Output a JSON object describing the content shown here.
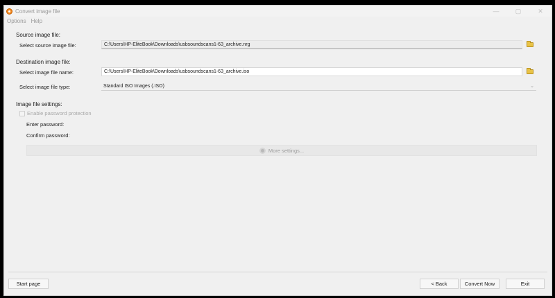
{
  "window": {
    "title": "Convert image file",
    "controls": {
      "minimize": "—",
      "maximize": "▢",
      "close": "✕"
    }
  },
  "menu": [
    "Options",
    "Help"
  ],
  "source": {
    "section_label": "Source image file:",
    "field_label": "Select source image file:",
    "value": "C:\\Users\\HP-EliteBook\\Downloads\\usbsoundscans1-63_archive.nrg"
  },
  "destination": {
    "section_label": "Destination image file:",
    "name_label": "Select image file name:",
    "name_value": "C:\\Users\\HP-EliteBook\\Downloads\\usbsoundscans1-63_archive.iso",
    "type_label": "Select image file type:",
    "type_value": "Standard ISO Images (.ISO)"
  },
  "settings": {
    "section_label": "Image file settings:",
    "password_checkbox_label": "Enable password protection",
    "password_checked": false,
    "enter_password_label": "Enter password:",
    "confirm_password_label": "Confirm password:",
    "more_settings_label": "More settings..."
  },
  "footer": {
    "start_page": "Start page",
    "back": "< Back",
    "convert_now": "Convert Now",
    "exit": "Exit"
  },
  "icons": {
    "app": "app-logo-icon",
    "browse": "folder-icon",
    "more": "gear-icon",
    "dropdown": "chevron-down-icon"
  },
  "colors": {
    "accent": "#f28a22",
    "folder": "#e9c347",
    "window_bg": "#f0f0f0"
  }
}
